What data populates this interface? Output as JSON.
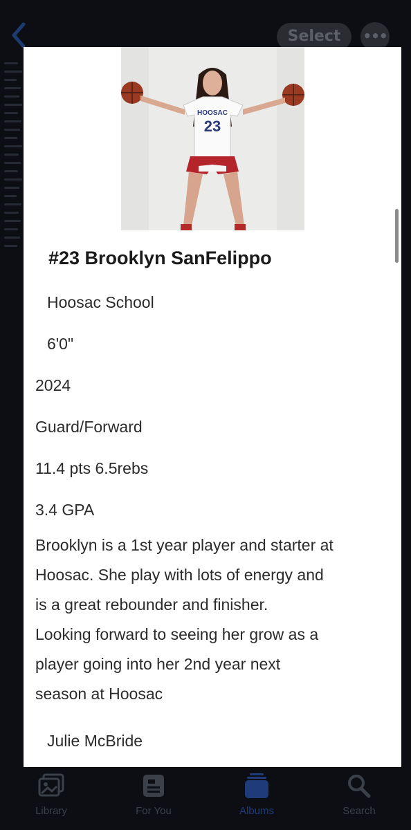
{
  "header": {
    "select_label": "Select",
    "more_label": "•••"
  },
  "card": {
    "photo": {
      "jersey_text": "HOOSAC",
      "jersey_number": "23"
    },
    "title": "#23 Brooklyn SanFelippo",
    "school": "Hoosac School",
    "height": "6'0\"",
    "class_year": "2024",
    "position": "Guard/Forward",
    "stats": "11.4 pts 6.5rebs",
    "gpa": "3.4 GPA",
    "bio_lines": [
      "Brooklyn is a 1st year player and starter at",
      "Hoosac. She play with lots of energy and",
      "is a great rebounder and finisher.",
      "Looking forward to seeing her grow as a",
      "player going into her 2nd year next",
      "season at Hoosac"
    ],
    "author": "Julie McBride"
  },
  "tabbar": {
    "items": [
      {
        "label": "Library",
        "icon": "photo-library-icon"
      },
      {
        "label": "For You",
        "icon": "for-you-icon"
      },
      {
        "label": "Albums",
        "icon": "albums-icon"
      },
      {
        "label": "Search",
        "icon": "search-icon"
      }
    ]
  },
  "colors": {
    "active_tab": "#1f3b7a",
    "card_background": "#ffffff",
    "app_background": "#0c0e14"
  }
}
